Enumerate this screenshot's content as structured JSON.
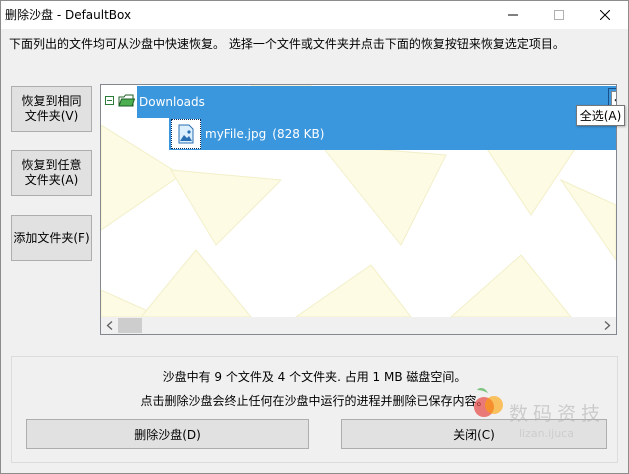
{
  "window": {
    "title": "删除沙盘 - DefaultBox"
  },
  "description": "下面列出的文件均可从沙盘中快速恢复。 选择一个文件或文件夹并点击下面的恢复按钮来恢复选定项目。",
  "side_buttons": {
    "restore_same_line1": "恢复到相同",
    "restore_same_line2": "文件夹(V)",
    "restore_any_line1": "恢复到任意",
    "restore_any_line2": "文件夹(A)",
    "add_folder": "添加文件夹(F)"
  },
  "tree": {
    "items": [
      {
        "name": "Downloads",
        "type": "folder"
      },
      {
        "name": "myFile.jpg",
        "size": "(828 KB)",
        "type": "file"
      }
    ],
    "select_all_checked": true
  },
  "tooltip": "全选(A)",
  "stats": {
    "line1": "沙盘中有 9 个文件及 4 个文件夹. 占用 1 MB 磁盘空间。",
    "line2": "点击删除沙盘会终止任何在沙盘中运行的进程并删除已保存内容。"
  },
  "bottom_buttons": {
    "delete": "删除沙盘(D)",
    "close": "关闭(C)"
  },
  "watermark": {
    "text": "数码资技",
    "url": "lizan.ijuca"
  },
  "colors": {
    "selection": "#3a96dd",
    "watermark_yellow": "#fdfbe4"
  },
  "icons": {
    "minimize": "minimize-icon",
    "maximize": "maximize-icon",
    "close": "close-icon",
    "folder": "folder-icon",
    "image": "image-file-icon",
    "checkbox": "checkbox-checked-icon",
    "scroll_left": "chevron-left-icon",
    "scroll_right": "chevron-right-icon"
  }
}
